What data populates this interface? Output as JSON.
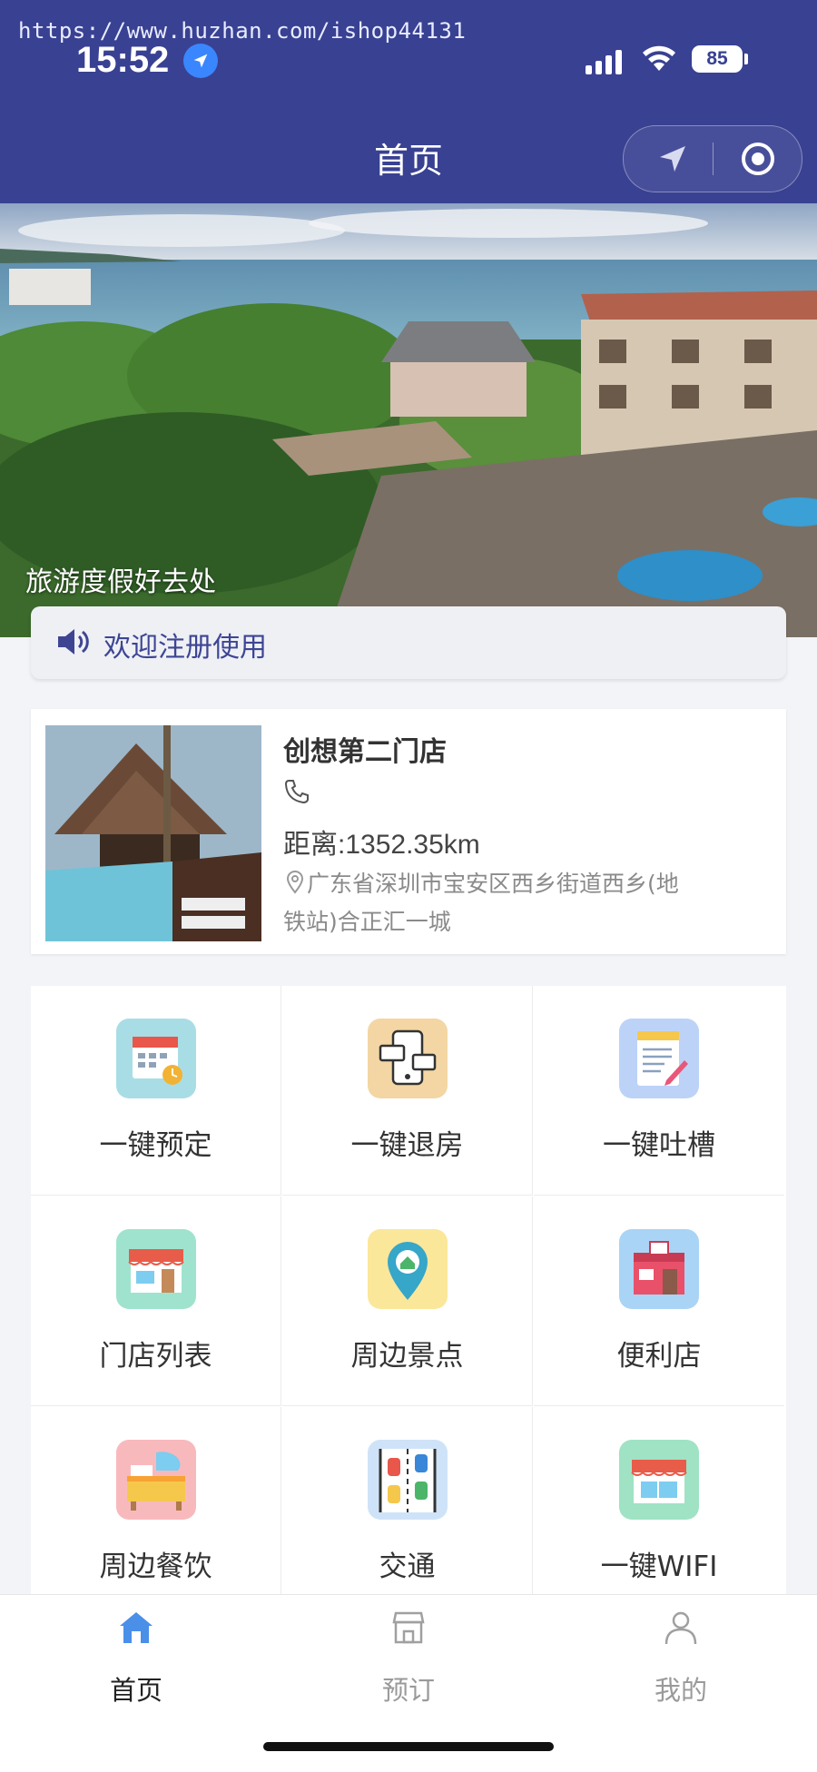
{
  "status_bar": {
    "watermark": "https://www.huzhan.com/ishop44131",
    "time": "15:52",
    "battery": "85"
  },
  "nav": {
    "title": "首页"
  },
  "banner": {
    "caption": "旅游度假好去处"
  },
  "notice": {
    "text": "欢迎注册使用"
  },
  "store": {
    "name": "创想第二门店",
    "distance": "距离:1352.35km",
    "address": "广东省深圳市宝安区西乡街道西乡(地铁站)合正汇一城"
  },
  "services": [
    {
      "label": "一键预定",
      "icon": "calendar-icon",
      "bg": "#a9dde6"
    },
    {
      "label": "一键退房",
      "icon": "phone-checkout-icon",
      "bg": "#f3d6a3"
    },
    {
      "label": "一键吐槽",
      "icon": "notepad-icon",
      "bg": "#bcd3f7"
    },
    {
      "label": "门店列表",
      "icon": "store-icon",
      "bg": "#9fe3cf"
    },
    {
      "label": "周边景点",
      "icon": "location-pin-icon",
      "bg": "#fbe79a"
    },
    {
      "label": "便利店",
      "icon": "convenience-store-icon",
      "bg": "#a9d4f5"
    },
    {
      "label": "周边餐饮",
      "icon": "food-stall-icon",
      "bg": "#f8b9bd"
    },
    {
      "label": "交通",
      "icon": "traffic-icon",
      "bg": "#cfe3f8"
    },
    {
      "label": "一键WIFI",
      "icon": "shop-wifi-icon",
      "bg": "#9fe3c4"
    }
  ],
  "tabs": [
    {
      "label": "首页",
      "icon": "home-icon",
      "active": true
    },
    {
      "label": "预订",
      "icon": "shop-icon",
      "active": false
    },
    {
      "label": "我的",
      "icon": "user-icon",
      "active": false
    }
  ],
  "colors": {
    "brand": "#394192",
    "active_tab": "#222222",
    "inactive_tab": "#9a9a9a",
    "home_icon": "#4a8fe8"
  }
}
